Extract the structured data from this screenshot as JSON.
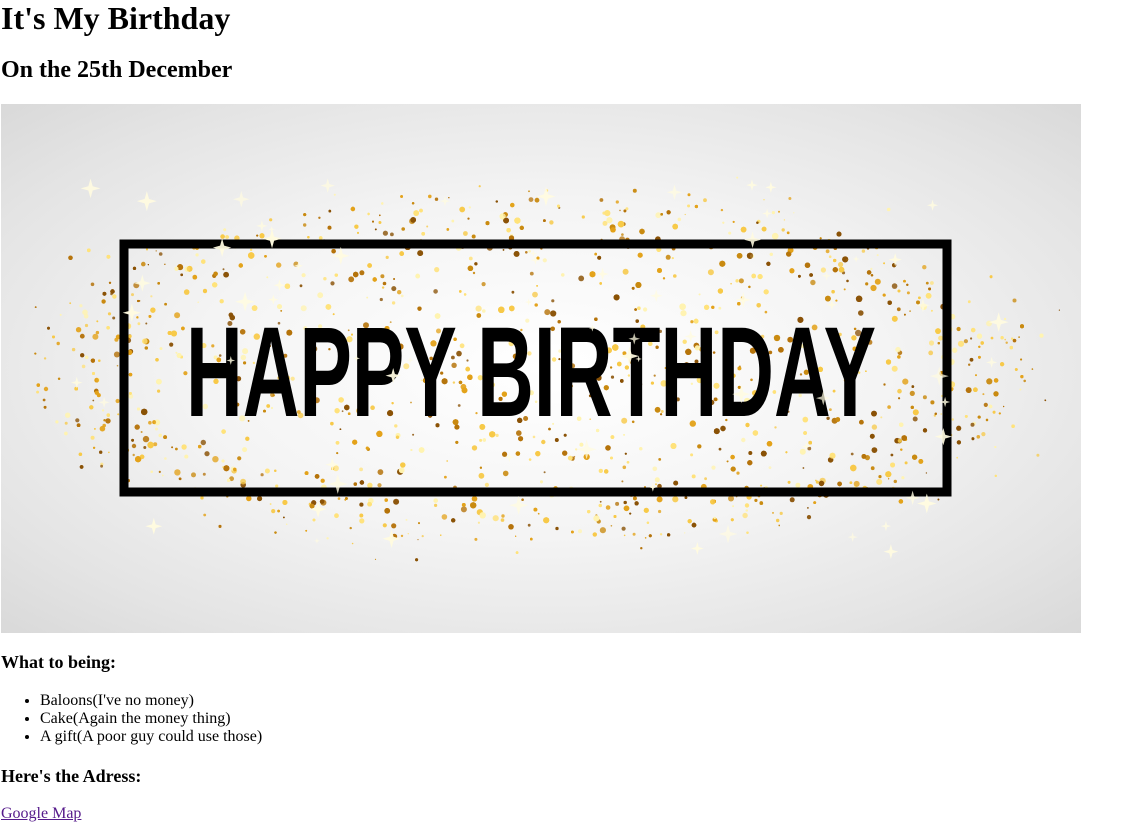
{
  "header": {
    "title": "It's My Birthday",
    "subtitle": "On the 25th December"
  },
  "banner": {
    "text": "HAPPY BIRTHDAY",
    "colors": {
      "glitter": [
        "#f7c948",
        "#e3a21a",
        "#c98a10",
        "#ffe27a",
        "#b5730a",
        "#8a5206",
        "#fff3b0"
      ],
      "frame": "#000000",
      "background": "#e6e6e6"
    }
  },
  "bring_section": {
    "heading": "What to being:",
    "items": [
      "Baloons(I've no money)",
      "Cake(Again the money thing)",
      "A gift(A poor guy could use those)"
    ]
  },
  "address_section": {
    "heading": "Here's the Adress:",
    "link_label": "Google Map"
  },
  "colors": {
    "visited_link": "#551a8b",
    "text": "#000000"
  }
}
